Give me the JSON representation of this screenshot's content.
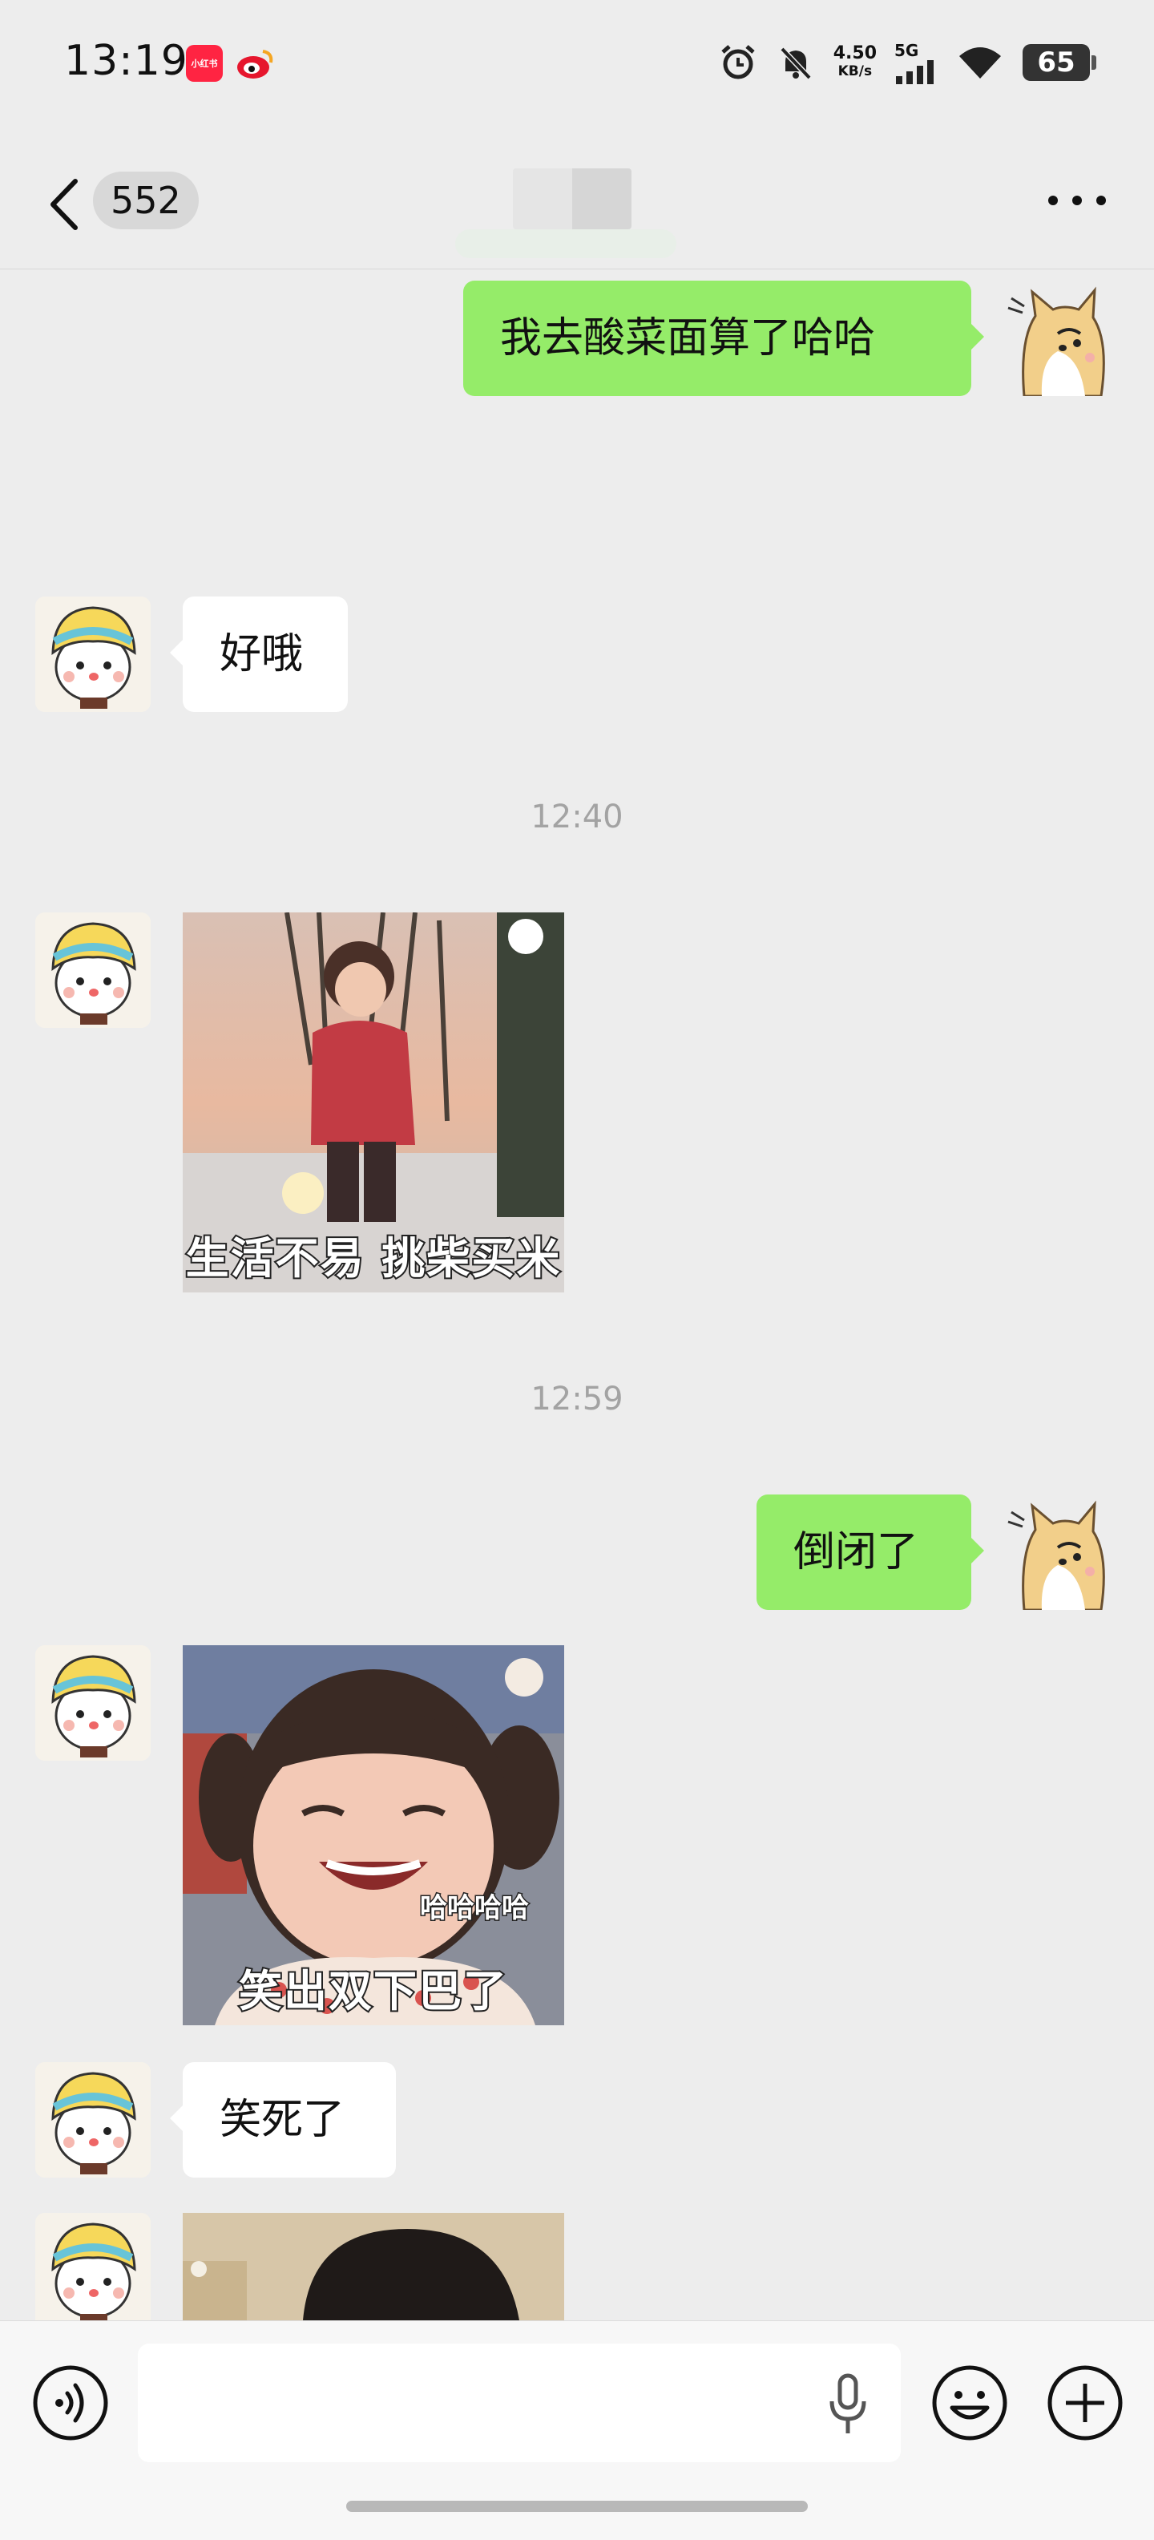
{
  "status_bar": {
    "time": "13:19",
    "app_icon_1": "小红书",
    "app_icon_2": "weibo-icon",
    "net_speed_value": "4.50",
    "net_speed_unit": "KB/s",
    "network": "5G",
    "battery": "65"
  },
  "nav": {
    "unread_count": "552",
    "icons": [
      "back-chevron-icon",
      "more-dots-icon"
    ]
  },
  "messages": [
    {
      "type": "text",
      "side": "mine",
      "text": "我去酸菜面算了哈哈"
    },
    {
      "type": "text",
      "side": "theirs",
      "text": "好哦"
    },
    {
      "type": "time",
      "text": "12:40"
    },
    {
      "type": "sticker",
      "side": "theirs",
      "caption": "生活不易 挑柴买米"
    },
    {
      "type": "time",
      "text": "12:59"
    },
    {
      "type": "text",
      "side": "mine",
      "text": "倒闭了"
    },
    {
      "type": "sticker",
      "side": "theirs",
      "caption": "笑出双下巴了",
      "small_text": "哈哈哈哈"
    },
    {
      "type": "text",
      "side": "theirs",
      "text": "笑死了"
    },
    {
      "type": "sticker",
      "side": "theirs",
      "caption": ""
    }
  ],
  "input_bar": {
    "placeholder": "",
    "icons": [
      "voice-toggle-icon",
      "microphone-icon",
      "emoji-icon",
      "plus-icon"
    ]
  },
  "colors": {
    "background": "#ededed",
    "my_bubble": "#95ec69",
    "their_bubble": "#ffffff",
    "timestamp": "#a3a3a3"
  }
}
